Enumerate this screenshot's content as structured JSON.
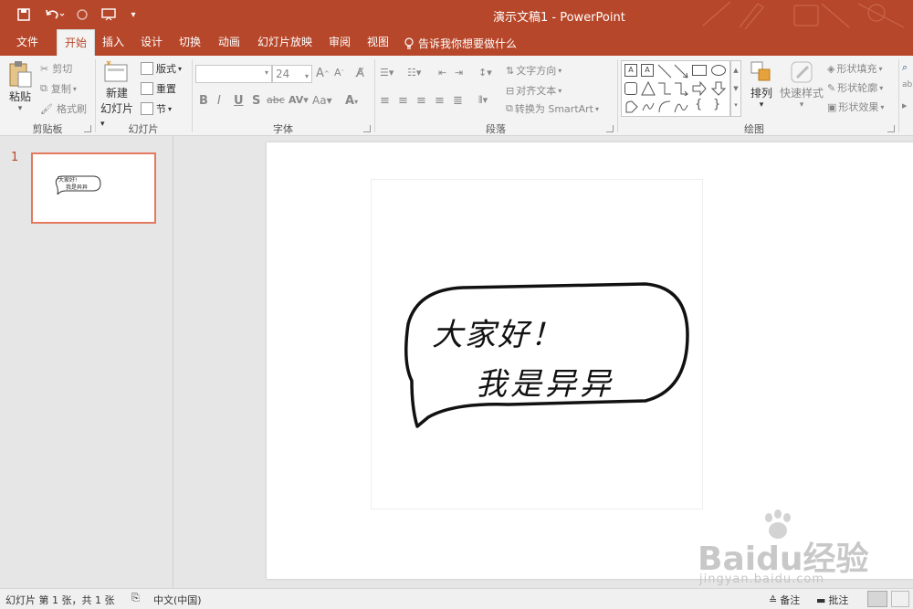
{
  "window": {
    "title": "演示文稿1 - PowerPoint"
  },
  "tabs": {
    "file": "文件",
    "home": "开始",
    "insert": "插入",
    "design": "设计",
    "transitions": "切换",
    "animations": "动画",
    "slideshow": "幻灯片放映",
    "review": "审阅",
    "view": "视图",
    "tellme": "告诉我你想要做什么"
  },
  "clipboard": {
    "paste": "粘贴",
    "cut": "剪切",
    "copy": "复制",
    "format_painter": "格式刷",
    "label": "剪贴板"
  },
  "slides_group": {
    "new_slide_line1": "新建",
    "new_slide_line2": "幻灯片",
    "layout": "版式",
    "reset": "重置",
    "section": "节",
    "label": "幻灯片"
  },
  "font": {
    "font_name": "",
    "font_size": "24",
    "bold": "B",
    "italic": "I",
    "underline": "U",
    "shadow": "S",
    "strike": "abc",
    "spacing": "AV",
    "case": "Aa",
    "label": "字体"
  },
  "paragraph": {
    "text_direction": "文字方向",
    "align_text": "对齐文本",
    "convert_smartart": "转换为 SmartArt",
    "label": "段落"
  },
  "drawing": {
    "arrange": "排列",
    "quick_styles": "快速样式",
    "shape_fill": "形状填充",
    "shape_outline": "形状轮廓",
    "shape_effects": "形状效果",
    "label": "绘图"
  },
  "thumbnails": [
    {
      "number": "1",
      "line1": "大家好!",
      "line2": "我是异异"
    }
  ],
  "slide": {
    "bubble_line1": "大家好！",
    "bubble_line2": "我是异异"
  },
  "watermark": {
    "brand": "Baidu经验",
    "url": "jingyan.baidu.com"
  },
  "status": {
    "slide_info": "幻灯片 第 1 张，共 1 张",
    "language": "中文(中国)",
    "notes": "备注",
    "comments": "批注"
  },
  "colors": {
    "accent": "#b7472a",
    "ribbon_bg": "#f3f3f3",
    "canvas_bg": "#e6e6e6"
  }
}
